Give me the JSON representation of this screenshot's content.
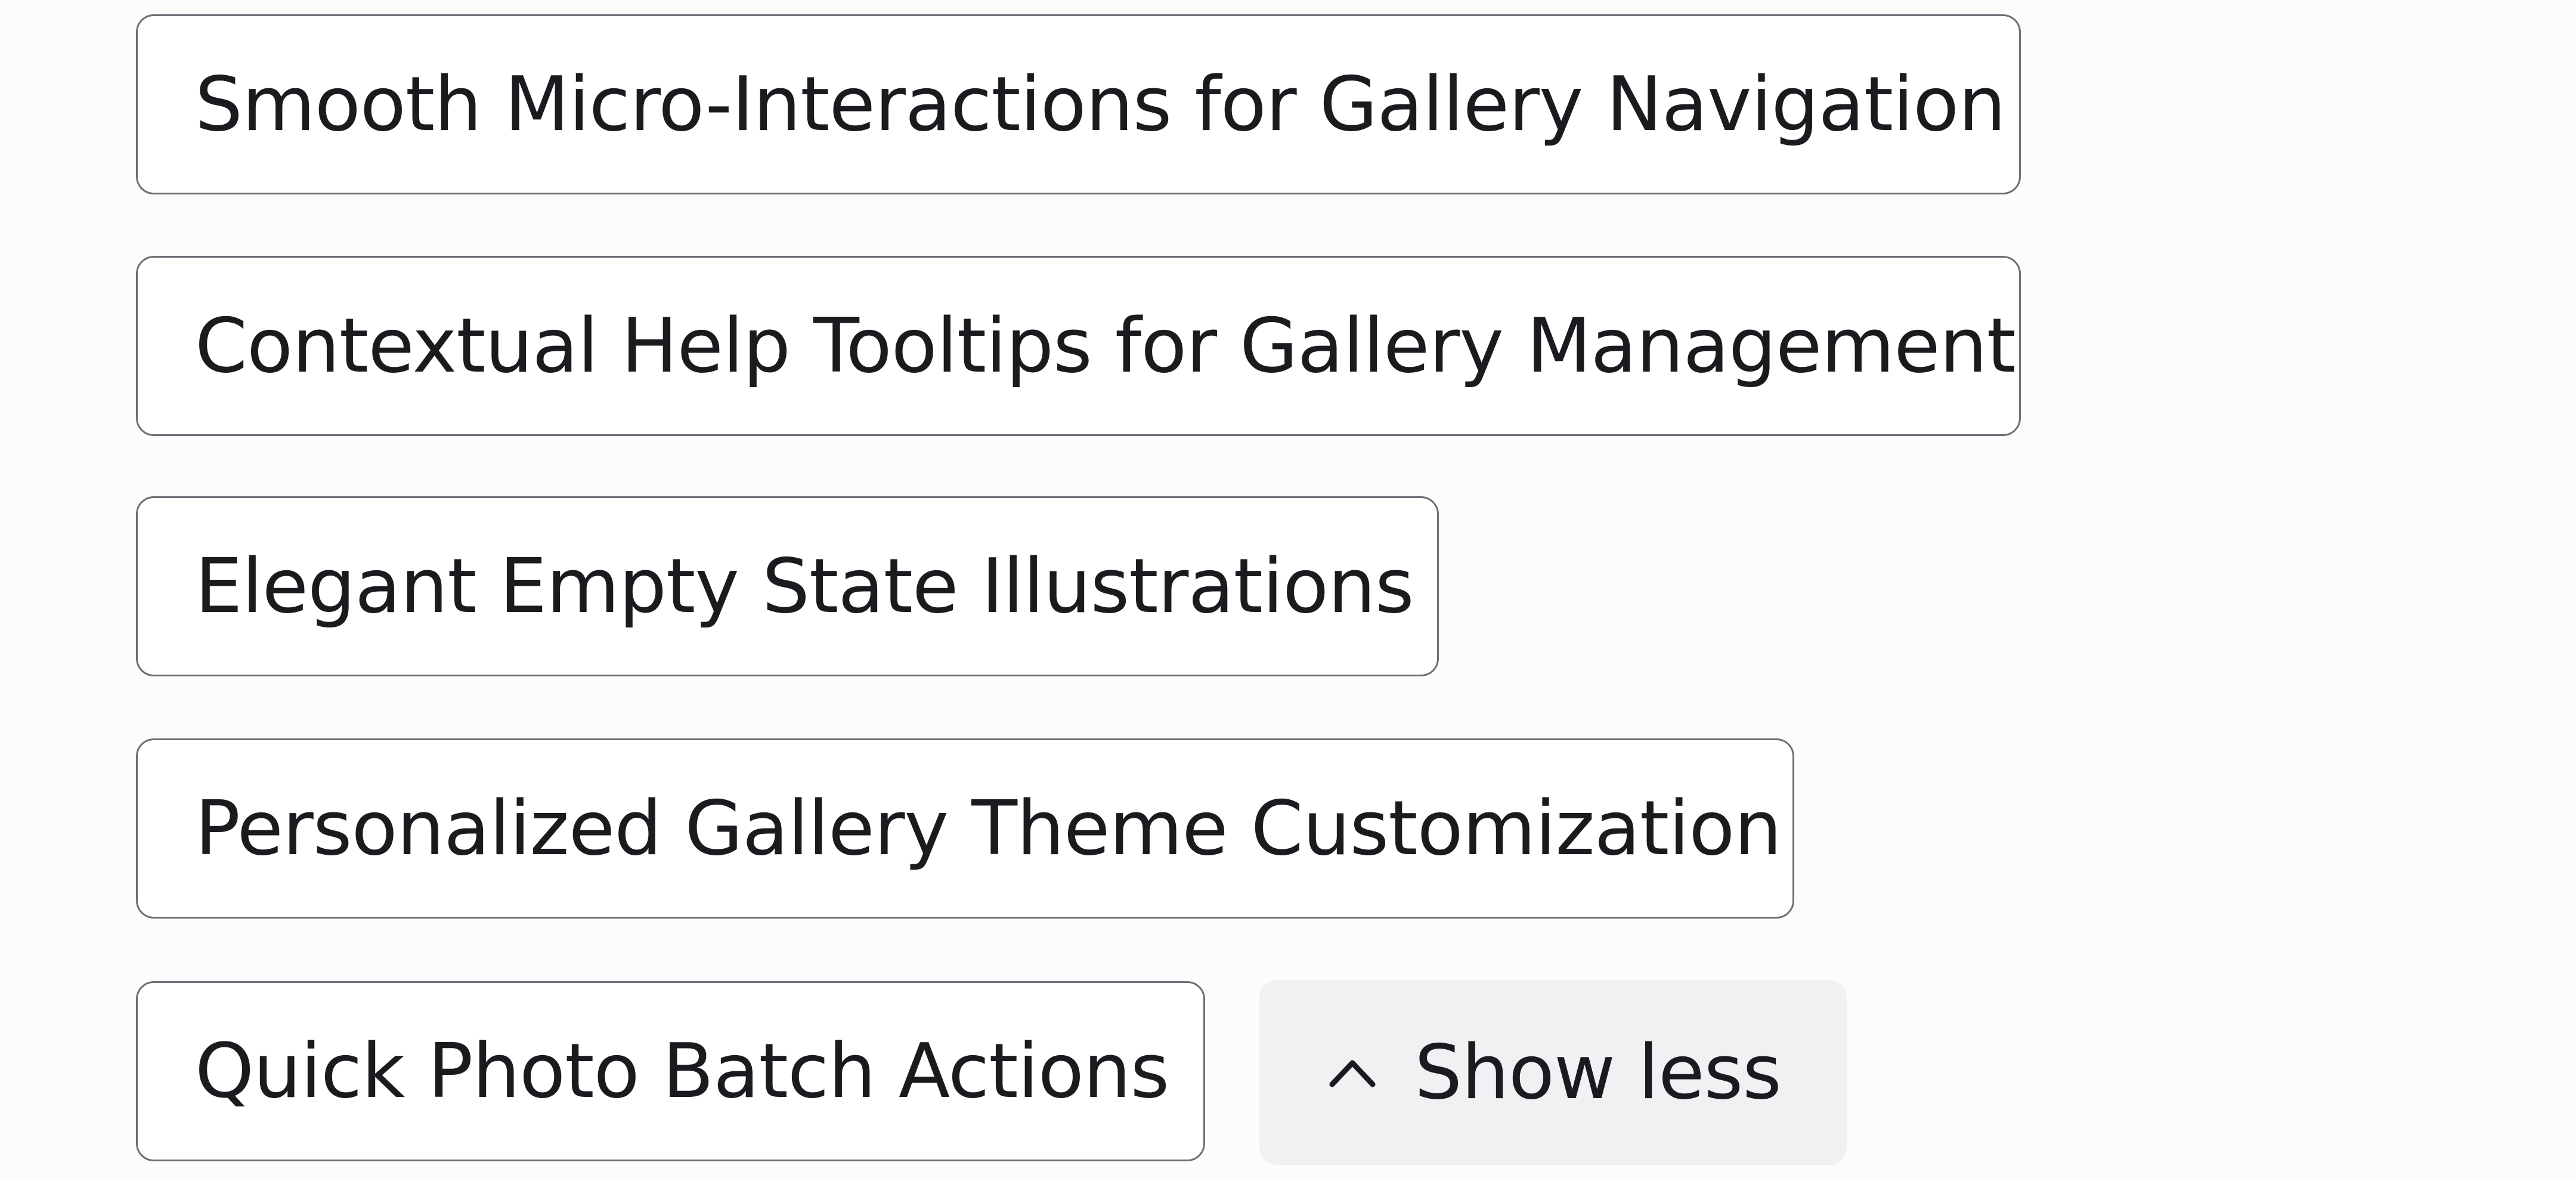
{
  "suggestions": [
    {
      "label": "Smooth Micro-Interactions for Gallery Navigation"
    },
    {
      "label": "Contextual Help Tooltips for Gallery Management"
    },
    {
      "label": "Elegant Empty State Illustrations"
    },
    {
      "label": "Personalized Gallery Theme Customization"
    },
    {
      "label": "Quick Photo Batch Actions"
    }
  ],
  "toggle": {
    "label": "Show less",
    "icon": "chevron-up-icon"
  }
}
